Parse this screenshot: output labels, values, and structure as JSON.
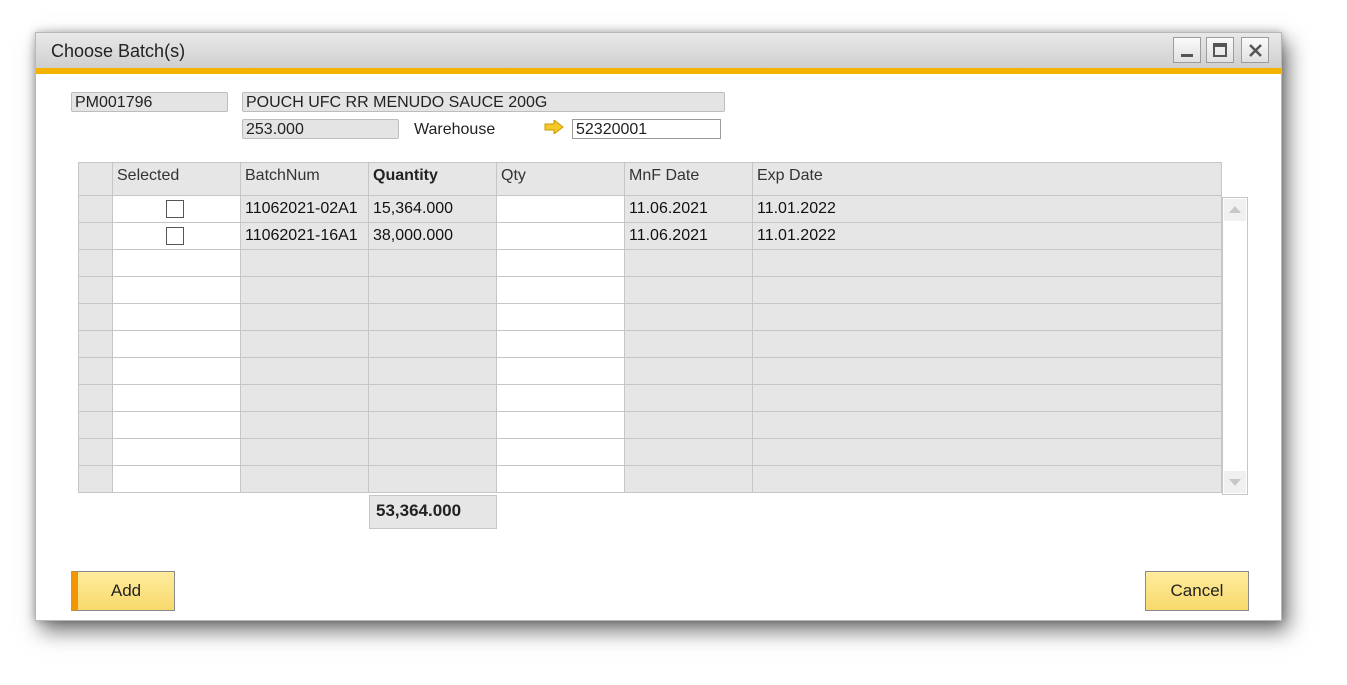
{
  "window": {
    "title": "Choose Batch(s)"
  },
  "header": {
    "item_code": "PM001796",
    "item_description": "POUCH UFC RR MENUDO SAUCE 200G",
    "quantity": "253.000",
    "warehouse_label": "Warehouse",
    "warehouse_value": "52320001"
  },
  "table": {
    "columns": [
      "Selected",
      "BatchNum",
      "Quantity",
      "Qty",
      "MnF Date",
      "Exp Date"
    ],
    "rows": [
      {
        "selected": false,
        "batch_num": "11062021-02A1",
        "quantity": "15,364.000",
        "qty": "",
        "mnf_date": "11.06.2021",
        "exp_date": "11.01.2022"
      },
      {
        "selected": false,
        "batch_num": "11062021-16A1",
        "quantity": "38,000.000",
        "qty": "",
        "mnf_date": "11.06.2021",
        "exp_date": "11.01.2022"
      }
    ],
    "total_quantity": "53,364.000"
  },
  "buttons": {
    "add": "Add",
    "cancel": "Cancel"
  },
  "colors": {
    "accent": "#f5b301",
    "button_fill": "#f7d96b",
    "add_marker": "#f29500"
  },
  "icons": {
    "link_arrow": "link-arrow-icon",
    "minimize": "minimize-icon",
    "maximize": "maximize-icon",
    "close": "close-icon"
  }
}
